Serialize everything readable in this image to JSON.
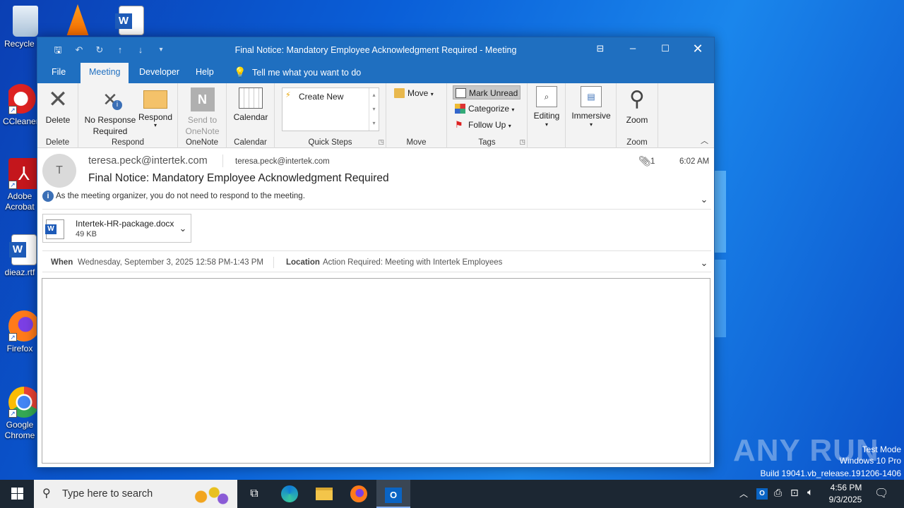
{
  "desktop": {
    "icons": [
      {
        "label": "Recycle Bin"
      },
      {
        "label": "CCleaner"
      },
      {
        "label": "Adobe Acrobat"
      },
      {
        "label": "dieaz.rtf"
      },
      {
        "label": "Firefox"
      },
      {
        "label": "Google Chrome"
      }
    ],
    "watermark": {
      "brand": "ANY RUN",
      "line1": "Test Mode",
      "line2": "Windows 10 Pro",
      "line3": "Build 19041.vb_release.191206-1406"
    }
  },
  "window": {
    "title": "Final Notice: Mandatory Employee Acknowledgment Required  -  Meeting",
    "tabs": [
      {
        "label": "File"
      },
      {
        "label": "Meeting"
      },
      {
        "label": "Developer"
      },
      {
        "label": "Help"
      }
    ],
    "tell_me": "Tell me what you want to do",
    "ribbon": {
      "delete": {
        "button": "Delete",
        "group": "Delete"
      },
      "respond": {
        "no_response_1": "No Response",
        "no_response_2": "Required",
        "respond": "Respond",
        "group": "Respond"
      },
      "onenote": {
        "send_1": "Send to",
        "send_2": "OneNote",
        "group": "OneNote"
      },
      "calendar": {
        "button": "Calendar",
        "group": "Calendar"
      },
      "quicksteps": {
        "create_new": "Create New",
        "group": "Quick Steps"
      },
      "move": {
        "button": "Move",
        "group": "Move"
      },
      "tags": {
        "mark_unread": "Mark Unread",
        "categorize": "Categorize",
        "follow_up": "Follow Up",
        "group": "Tags"
      },
      "editing": {
        "button": "Editing"
      },
      "immersive": {
        "button": "Immersive"
      },
      "zoom": {
        "button": "Zoom",
        "group": "Zoom"
      }
    },
    "message": {
      "avatar_letter": "T",
      "from": "teresa.peck@intertek.com",
      "to": "teresa.peck@intertek.com",
      "attachment_count": "1",
      "time": "6:02 AM",
      "subject": "Final Notice: Mandatory Employee Acknowledgment Required",
      "info": "As the meeting organizer, you do not need to respond to the meeting.",
      "attachment": {
        "name": "Intertek-HR-package.docx",
        "size": "49 KB"
      },
      "when_label": "When",
      "when_value": "Wednesday, September 3, 2025 12:58 PM-1:43 PM",
      "location_label": "Location",
      "location_value": "Action Required: Meeting with Intertek Employees"
    }
  },
  "taskbar": {
    "search_placeholder": "Type here to search",
    "clock_time": "4:56 PM",
    "clock_date": "9/3/2025"
  },
  "colors": {
    "accent": "#1f6fc0",
    "ribbon_bg": "#f3f3f3",
    "taskbar_bg": "#1c2733"
  }
}
